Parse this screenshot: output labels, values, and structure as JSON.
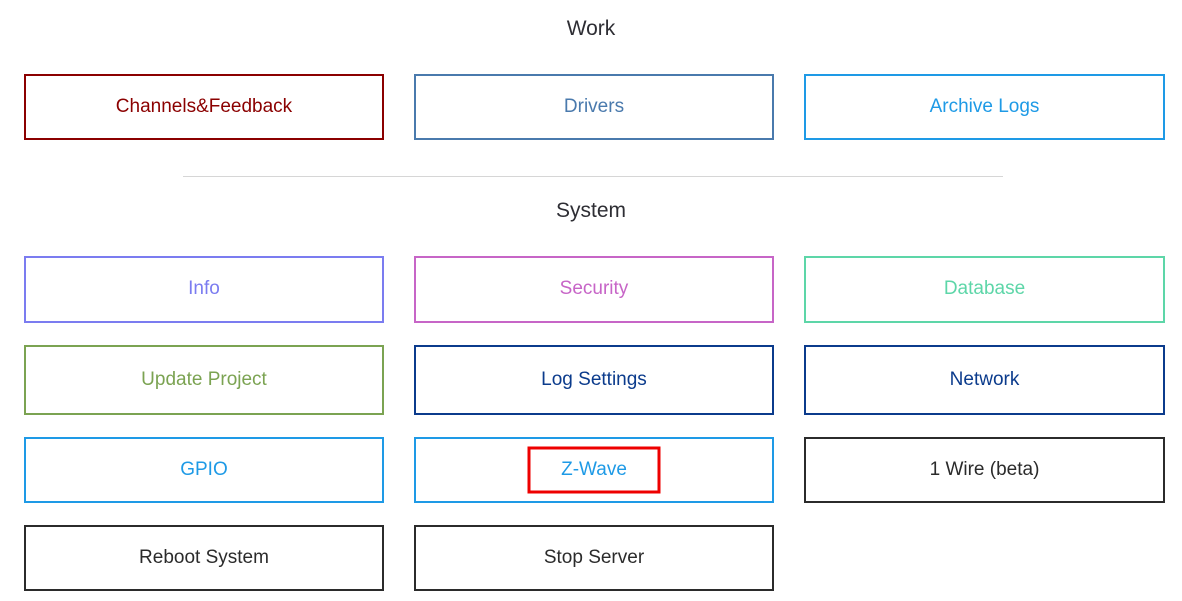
{
  "sections": [
    {
      "id": "work",
      "title": "Work",
      "buttons": [
        {
          "label": "Channels&Feedback",
          "color": "#8b0000",
          "border": "#8b0000",
          "annotated": false
        },
        {
          "label": "Drivers",
          "color": "#4a7aad",
          "border": "#4a7aad",
          "annotated": false
        },
        {
          "label": "Archive Logs",
          "color": "#1e9ae6",
          "border": "#1e9ae6",
          "annotated": false
        }
      ]
    },
    {
      "id": "system",
      "title": "System",
      "buttons": [
        {
          "label": "Info",
          "color": "#7b7cf0",
          "border": "#7b7cf0",
          "annotated": false
        },
        {
          "label": "Security",
          "color": "#c765c7",
          "border": "#c765c7",
          "annotated": false
        },
        {
          "label": "Database",
          "color": "#5dd6a8",
          "border": "#5dd6a8",
          "annotated": false
        },
        {
          "label": "Update Project",
          "color": "#7ba352",
          "border": "#7ba352",
          "annotated": false
        },
        {
          "label": "Log Settings",
          "color": "#0b3b8c",
          "border": "#0b3b8c",
          "annotated": false
        },
        {
          "label": "Network",
          "color": "#0b3b8c",
          "border": "#0b3b8c",
          "annotated": false
        },
        {
          "label": "GPIO",
          "color": "#1e9ae6",
          "border": "#1e9ae6",
          "annotated": false
        },
        {
          "label": "Z-Wave",
          "color": "#1e9ae6",
          "border": "#1e9ae6",
          "annotated": true
        },
        {
          "label": "1 Wire (beta)",
          "color": "#2b2b2b",
          "border": "#2b2b2b",
          "annotated": false
        },
        {
          "label": "Reboot System",
          "color": "#2b2b2b",
          "border": "#2b2b2b",
          "annotated": false
        },
        {
          "label": "Stop Server",
          "color": "#2b2b2b",
          "border": "#2b2b2b",
          "annotated": false
        },
        {
          "label": "",
          "color": "#2b2b2b",
          "border": "#2b2b2b",
          "annotated": false,
          "empty": true
        }
      ]
    }
  ],
  "annotation": {
    "color": "#ee0000",
    "target": "Z-Wave"
  },
  "divider": {
    "color": "#d6d6d6"
  }
}
